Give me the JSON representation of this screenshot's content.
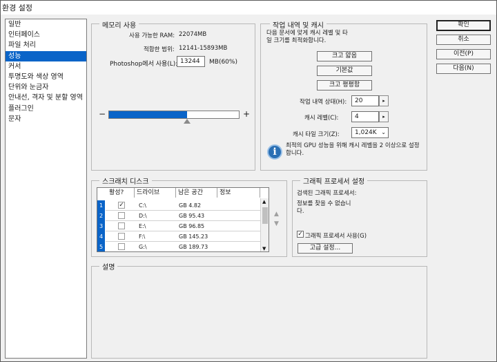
{
  "window": {
    "title": "환경 설정"
  },
  "nav": {
    "items": [
      {
        "label": "일반",
        "selected": false
      },
      {
        "label": "인터페이스",
        "selected": false
      },
      {
        "label": "파일 처리",
        "selected": false
      },
      {
        "label": "성능",
        "selected": true
      },
      {
        "label": "커서",
        "selected": false
      },
      {
        "label": "투명도와 색상 영역",
        "selected": false
      },
      {
        "label": "단위와 눈금자",
        "selected": false
      },
      {
        "label": "안내선, 격자 및 분할 영역",
        "selected": false
      },
      {
        "label": "플러그인",
        "selected": false
      },
      {
        "label": "문자",
        "selected": false
      }
    ]
  },
  "memory": {
    "title": "메모리 사용",
    "available_label": "사용 가능한 RAM:",
    "available_value": "22074MB",
    "ideal_label": "적합한 범위:",
    "ideal_value": "12141-15893MB",
    "use_label": "Photoshop에서 사용(L):",
    "use_value": "13244",
    "use_suffix": "MB(60%)",
    "slider_fraction": 0.6,
    "minus": "−",
    "plus": "+"
  },
  "history": {
    "title": "작업 내역 및 캐시",
    "desc": "다음 문서에 맞게 캐시 레벨 및 타일 크기를 최적화합니다.",
    "btn_small": "크고 얇음",
    "btn_default": "기본값",
    "btn_flat": "크고 평평함",
    "states_label": "작업 내역 상태(H):",
    "states_value": "20",
    "levels_label": "캐시 레벨(C):",
    "levels_value": "4",
    "tile_label": "캐시 타일 크기(Z):",
    "tile_value": "1,024K",
    "info_text": "최적의 GPU 성능을 위해 캐시 레벨을 2 이상으로 설정합니다."
  },
  "scratch": {
    "title": "스크래치 디스크",
    "headers": [
      "활성?",
      "드라이브",
      "남은 공간",
      "정보"
    ],
    "rows": [
      {
        "num": "1",
        "active": "✓",
        "drive": "C:\\",
        "space": "GB 4.82"
      },
      {
        "num": "2",
        "active": "",
        "drive": "D:\\",
        "space": "GB 95.43"
      },
      {
        "num": "3",
        "active": "",
        "drive": "E:\\",
        "space": "GB 96.85"
      },
      {
        "num": "4",
        "active": "",
        "drive": "F:\\",
        "space": "GB 145.23"
      },
      {
        "num": "5",
        "active": "",
        "drive": "G:\\",
        "space": "GB 189.73"
      }
    ]
  },
  "gpu": {
    "title": "그래픽 프로세서 설정",
    "detected_label": "검색된 그래픽 프로세서:",
    "detected_value": "정보를 찾을 수 없습니다.",
    "use_label": "그래픽 프로세서 사용(G)",
    "use_checked": "✓",
    "advanced": "고급 설정..."
  },
  "description": {
    "title": "설명"
  },
  "buttons": {
    "ok": "확인",
    "cancel": "취소",
    "prev": "이전(P)",
    "next": "다음(N)"
  },
  "colors": {
    "accent": "#0a64c8",
    "panel": "#f0f0f0"
  }
}
